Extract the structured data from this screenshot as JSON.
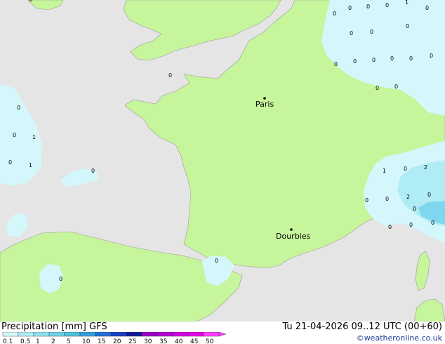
{
  "title": "Precipitation [mm]",
  "model": "GFS",
  "datetime": "Tu 21-04-2026 09..12 UTC (00+60)",
  "credit": "©weatheronline.co.uk",
  "cities": [
    {
      "name": "Paris"
    },
    {
      "name": "Dourbies"
    }
  ],
  "legend": {
    "ticks": [
      "0.1",
      "0.5",
      "1",
      "2",
      "5",
      "10",
      "15",
      "20",
      "25",
      "30",
      "35",
      "40",
      "45",
      "50"
    ],
    "colors": [
      "#d4f7fb",
      "#b0ecf5",
      "#90e0ef",
      "#6cd2e8",
      "#4fc2e0",
      "#2f9de0",
      "#1f6fd6",
      "#173fc0",
      "#101a96",
      "#9600c8",
      "#b400d4",
      "#d200e0",
      "#e800e6",
      "#ff3cff"
    ]
  },
  "colors": {
    "land": "#c6f59c",
    "sea": "#e5e5e5",
    "precip_light": "#d4f7fb",
    "precip_mid": "#b0ecf5",
    "precip_heavy": "#7fd6ef",
    "border": "#9a9a9a"
  },
  "values": [
    "0",
    "0",
    "0",
    "1",
    "0",
    "0",
    "0",
    "0",
    "0",
    "0",
    "0",
    "0",
    "0",
    "0",
    "0",
    "0",
    "0",
    "0",
    "0",
    "1",
    "0",
    "1",
    "0",
    "2",
    "2",
    "0",
    "1",
    "0",
    "0",
    "0",
    "0",
    "0",
    "0",
    "0",
    "0",
    "0",
    "0",
    "0"
  ]
}
